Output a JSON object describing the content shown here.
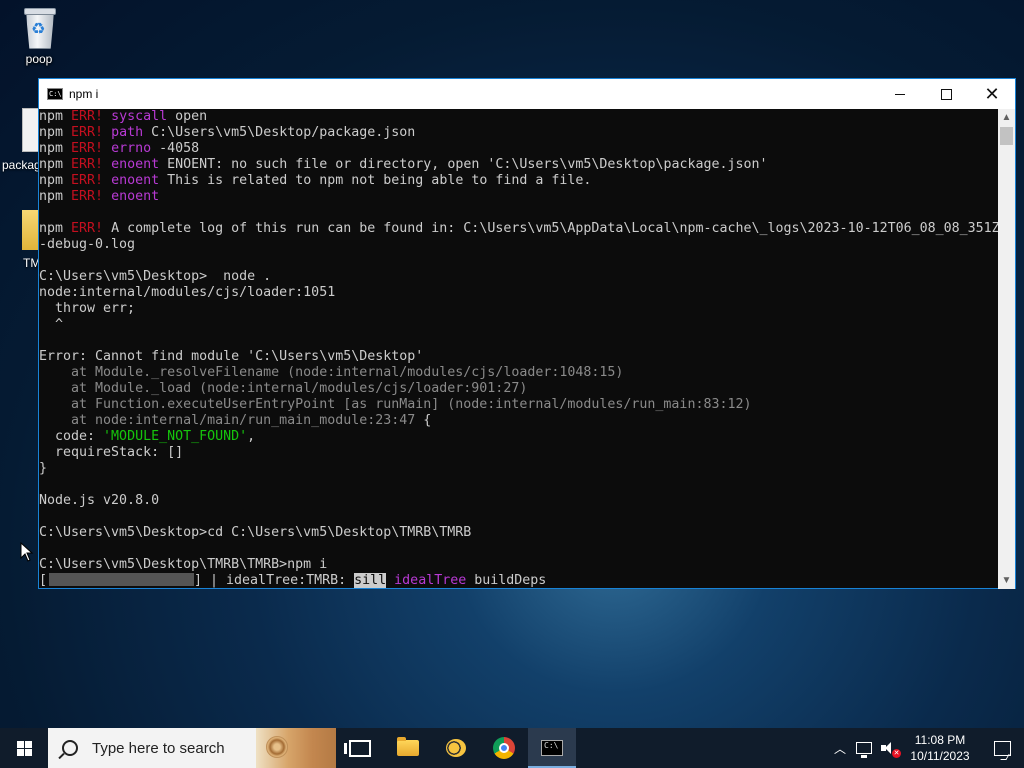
{
  "desktop": {
    "icons": [
      {
        "label": "poop",
        "icon": "recycle-bin-icon"
      },
      {
        "label": "packag",
        "icon": "file-icon"
      },
      {
        "label": "TM",
        "icon": "folder-icon"
      }
    ]
  },
  "window": {
    "title": "npm i",
    "icon": "console-icon",
    "buttons": {
      "minimize": "minimize-icon",
      "maximize": "maximize-icon",
      "close": "close-icon"
    }
  },
  "console": {
    "lines": [
      {
        "p": "npm ",
        "e": "ERR!",
        "k": "syscall",
        "v": " open"
      },
      {
        "p": "npm ",
        "e": "ERR!",
        "k": "path",
        "v": " C:\\Users\\vm5\\Desktop/package.json"
      },
      {
        "p": "npm ",
        "e": "ERR!",
        "k": "errno",
        "v": " -4058"
      },
      {
        "p": "npm ",
        "e": "ERR!",
        "k": "enoent",
        "v": " ENOENT: no such file or directory, open 'C:\\Users\\vm5\\Desktop\\package.json'"
      },
      {
        "p": "npm ",
        "e": "ERR!",
        "k": "enoent",
        "v": " This is related to npm not being able to find a file."
      },
      {
        "p": "npm ",
        "e": "ERR!",
        "k": "enoent",
        "v": ""
      },
      {
        "t": ""
      },
      {
        "p": "npm ",
        "e": "ERR!",
        "k": "",
        "v": " A complete log of this run can be found in: C:\\Users\\vm5\\AppData\\Local\\npm-cache\\_logs\\2023-10-12T06_08_08_351Z"
      },
      {
        "t": "-debug-0.log"
      },
      {
        "t": ""
      },
      {
        "t": "C:\\Users\\vm5\\Desktop>  node ."
      },
      {
        "t": "node:internal/modules/cjs/loader:1051"
      },
      {
        "t": "  throw err;"
      },
      {
        "t": "  ^"
      },
      {
        "t": ""
      },
      {
        "t": "Error: Cannot find module 'C:\\Users\\vm5\\Desktop'"
      },
      {
        "g": "    at Module._resolveFilename (node:internal/modules/cjs/loader:1048:15)"
      },
      {
        "g": "    at Module._load (node:internal/modules/cjs/loader:901:27)"
      },
      {
        "g": "    at Function.executeUserEntryPoint [as runMain] (node:internal/modules/run_main:83:12)"
      },
      {
        "g": "    at node:internal/main/run_main_module:23:47",
        "tail": " {"
      },
      {
        "c": "  code: ",
        "s": "'MODULE_NOT_FOUND'",
        "after": ","
      },
      {
        "t": "  requireStack: []"
      },
      {
        "t": "}"
      },
      {
        "t": ""
      },
      {
        "t": "Node.js v20.8.0"
      },
      {
        "t": ""
      },
      {
        "t": "C:\\Users\\vm5\\Desktop>cd C:\\Users\\vm5\\Desktop\\TMRB\\TMRB"
      },
      {
        "t": ""
      },
      {
        "t": "C:\\Users\\vm5\\Desktop\\TMRB\\TMRB>npm i"
      }
    ],
    "progress": {
      "open": "[",
      "close": "] | idealTree:TMRB: ",
      "level": "sill",
      "tag": "idealTree",
      "msg": " buildDeps"
    }
  },
  "taskbar": {
    "search_placeholder": "Type here to search",
    "apps": [
      {
        "name": "task-view",
        "icon": "task-view-icon"
      },
      {
        "name": "file-explorer",
        "icon": "folder-icon"
      },
      {
        "name": "bee-app",
        "icon": "bee-icon"
      },
      {
        "name": "chrome",
        "icon": "chrome-icon"
      },
      {
        "name": "command-prompt",
        "icon": "console-icon",
        "active": true
      }
    ],
    "clock": {
      "time": "11:08 PM",
      "date": "10/11/2023"
    }
  }
}
